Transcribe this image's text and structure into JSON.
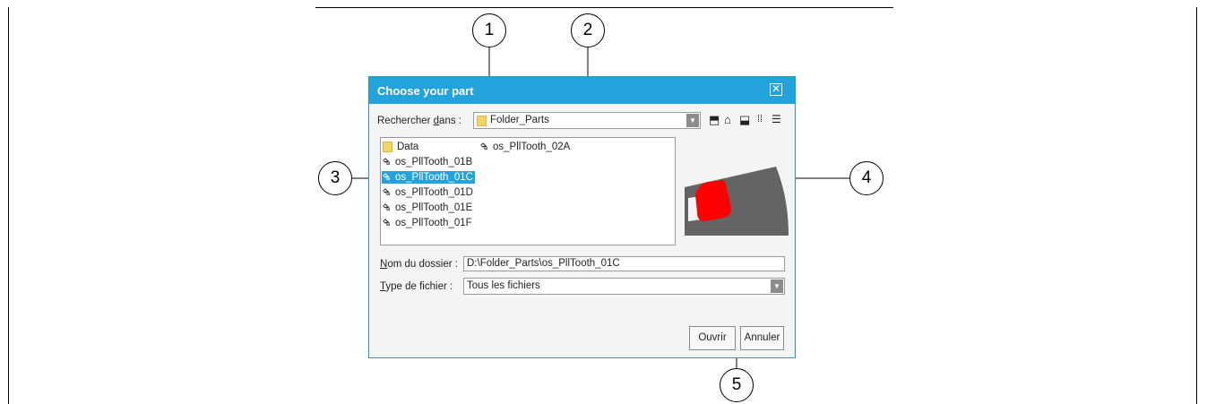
{
  "callouts": [
    "1",
    "2",
    "3",
    "4",
    "5"
  ],
  "dialog": {
    "title": "Choose your part",
    "close_icon": "close-icon",
    "look_in": {
      "label_pre": "Rechercher ",
      "label_u": "d",
      "label_post": "ans :",
      "value": "Folder_Parts"
    },
    "toolbar_icons": [
      "up-folder-icon",
      "home-icon",
      "new-folder-icon",
      "list-view-icon",
      "details-view-icon"
    ],
    "files": [
      {
        "name": "Data",
        "icon": "folder-icon",
        "selected": false
      },
      {
        "name": "os_PllTooth_01B",
        "icon": "part-icon",
        "selected": false
      },
      {
        "name": "os_PllTooth_01C",
        "icon": "part-icon",
        "selected": true
      },
      {
        "name": "os_PllTooth_01D",
        "icon": "part-icon",
        "selected": false
      },
      {
        "name": "os_PllTooth_01E",
        "icon": "part-icon",
        "selected": false
      },
      {
        "name": "os_PllTooth_01F",
        "icon": "part-icon",
        "selected": false
      },
      {
        "name": "os_PllTooth_02A",
        "icon": "part-icon",
        "selected": false
      }
    ],
    "folder_name": {
      "label_u": "N",
      "label_post": "om du dossier :",
      "value": "D:\\Folder_Parts\\os_PllTooth_01C"
    },
    "file_type": {
      "label_u": "T",
      "label_post": "ype de fichier :",
      "value": "Tous les fichiers"
    },
    "buttons": {
      "open": "Ouvrir",
      "cancel": "Annuler"
    },
    "colors": {
      "titlebar": "#22a3dc",
      "selection": "#22a3dc",
      "preview_body": "#646464",
      "preview_tooth": "#ff0000"
    }
  }
}
